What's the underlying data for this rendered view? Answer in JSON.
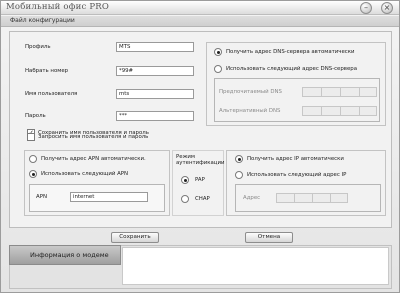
{
  "app": {
    "title": "Мобильный офис PRO",
    "minimize_glyph": "–",
    "close_glyph": "×"
  },
  "section": {
    "title": "Файл конфигурации"
  },
  "profile_form": {
    "profile_label": "Профиль",
    "profile_value": "MTS",
    "dial_number_label": "Набрать номер",
    "dial_number_value": "*99#",
    "username_label": "Имя пользователя",
    "username_value": "mts",
    "password_label": "Пароль",
    "password_value": "***",
    "save_credentials_label": "Сохранить имя пользователя и пароль",
    "save_credentials_checked": true,
    "ask_credentials_label": "Запросить имя пользователя и пароль",
    "ask_credentials_checked": false
  },
  "dns": {
    "auto_label": "Получить адрес DNS-сервера автоматически",
    "manual_label": "Использовать следующий адрес DNS-сервера",
    "preferred_label": "Предпочитаемый DNS",
    "alternate_label": "Альтернативный DNS"
  },
  "apn": {
    "auto_label": "Получить адрес APN автоматически.",
    "manual_label": "Использовать следующий APN",
    "apn_label": "APN",
    "apn_value": "internet"
  },
  "auth": {
    "title": "Режим аутентификации",
    "pap_label": "PAP",
    "chap_label": "CHAP"
  },
  "ip": {
    "auto_label": "Получить адрес IP автоматически",
    "manual_label": "Использовать следующий адрес IP",
    "address_label": "Адрес"
  },
  "buttons": {
    "save_label": "Сохранить",
    "cancel_label": "Отмена"
  },
  "bottom": {
    "modem_info_label": "Информация о модеме"
  }
}
